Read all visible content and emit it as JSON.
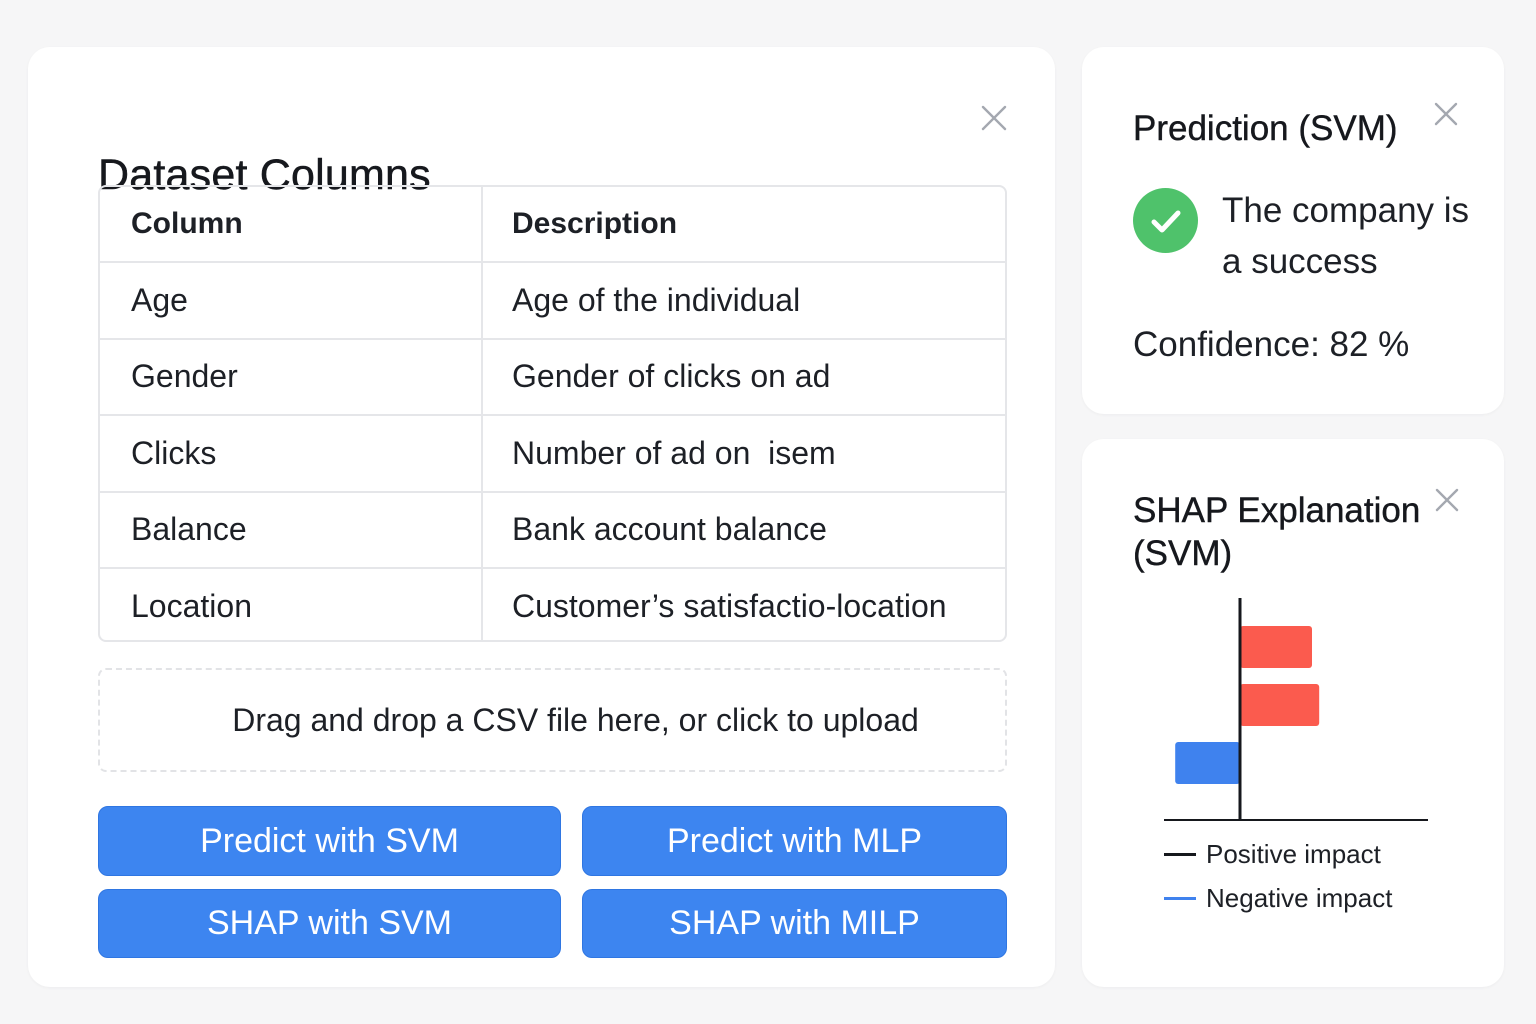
{
  "dataset": {
    "title": "Dataset Columns",
    "table": {
      "headers": [
        "Column",
        "Description"
      ],
      "rows": [
        [
          "Age",
          "Age of the individual"
        ],
        [
          "Gender",
          "Gender of clicks on ad"
        ],
        [
          "Clicks",
          "Number of ad on  isem"
        ],
        [
          "Balance",
          "Bank account balance"
        ],
        [
          "Location",
          "Customer’s satisfactio-location"
        ]
      ]
    },
    "dropzone_text": "Drag and drop a CSV file here, or click to upload",
    "buttons": {
      "predict_svm": "Predict with SVM",
      "predict_mlp": "Predict with MLP",
      "shap_svm": "SHAP with SVM",
      "shap_mlp": "SHAP with MILP"
    }
  },
  "prediction": {
    "title": "Prediction (SVM)",
    "result": "The company is a success",
    "confidence": "Confidence: 82 %"
  },
  "shap": {
    "title": "SHAP Explanation (SVM)",
    "legend": {
      "positive": "Positive impact",
      "negative": "Negative impact"
    }
  },
  "chart_data": {
    "type": "bar",
    "orientation": "horizontal",
    "title": "SHAP Explanation (SVM)",
    "categories": [
      "",
      "",
      ""
    ],
    "values": [
      1.0,
      1.1,
      -0.9
    ],
    "colors": [
      "#fb5b4e",
      "#fb5b4e",
      "#3f82ee"
    ],
    "legend": [
      "Positive impact",
      "Negative impact"
    ],
    "legend_colors": [
      "#16181d",
      "#3f82ee"
    ],
    "legend_placement": "bottom",
    "grid": false
  },
  "colors": {
    "accent": "#3d85f0",
    "success": "#4fc26b",
    "positive_bar": "#fb5b4e",
    "negative_bar": "#3f82ee"
  },
  "icons": {
    "close": "close-icon",
    "success": "check-circle-icon"
  }
}
